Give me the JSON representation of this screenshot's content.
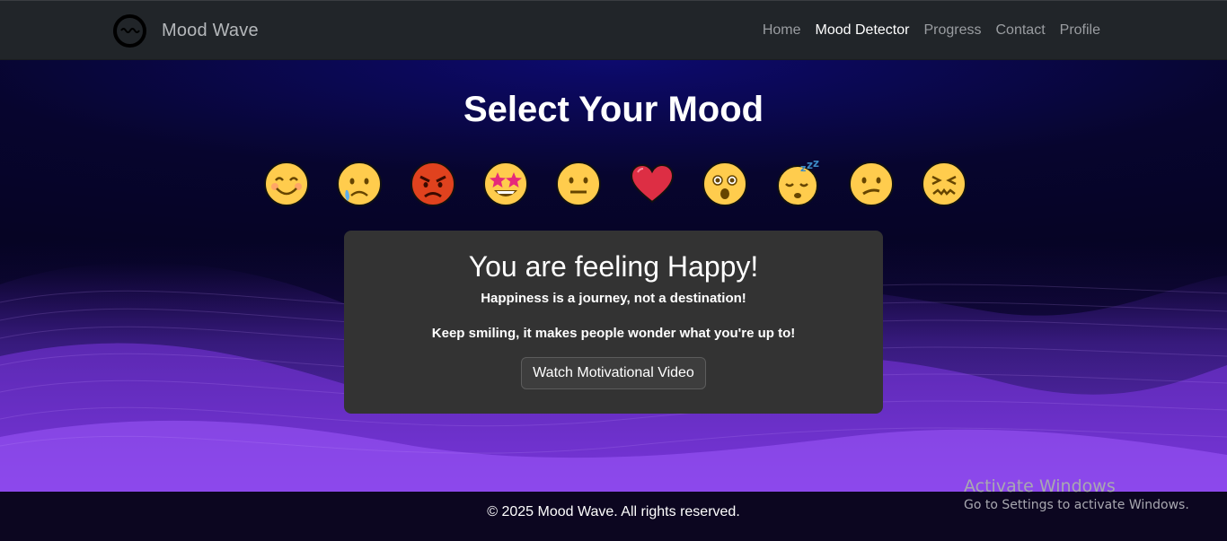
{
  "navbar": {
    "brand": "Mood Wave",
    "links": [
      {
        "label": "Home",
        "active": false
      },
      {
        "label": "Mood Detector",
        "active": true
      },
      {
        "label": "Progress",
        "active": false
      },
      {
        "label": "Contact",
        "active": false
      },
      {
        "label": "Profile",
        "active": false
      }
    ]
  },
  "main": {
    "title": "Select Your Mood",
    "moods": [
      {
        "icon": "smiling-face-icon",
        "mood": "happy"
      },
      {
        "icon": "crying-face-icon",
        "mood": "sad"
      },
      {
        "icon": "angry-face-icon",
        "mood": "angry"
      },
      {
        "icon": "star-struck-face-icon",
        "mood": "excited"
      },
      {
        "icon": "neutral-face-icon",
        "mood": "neutral"
      },
      {
        "icon": "red-heart-icon",
        "mood": "love"
      },
      {
        "icon": "astonished-face-icon",
        "mood": "surprised"
      },
      {
        "icon": "sleeping-face-icon",
        "mood": "tired"
      },
      {
        "icon": "confused-face-icon",
        "mood": "confused"
      },
      {
        "icon": "confounded-face-icon",
        "mood": "stressed"
      }
    ]
  },
  "card": {
    "title": "You are feeling Happy!",
    "quote": "Happiness is a journey, not a destination!",
    "tip": "Keep smiling, it makes people wonder what you're up to!",
    "button_label": "Watch Motivational Video"
  },
  "footer": {
    "text": "© 2025 Mood Wave. All rights reserved."
  },
  "watermark": {
    "title": "Activate Windows",
    "subtitle": "Go to Settings to activate Windows."
  },
  "colors": {
    "navbar_bg": "#212529",
    "card_bg": "#333333",
    "accent_purple": "#7b2ff7"
  }
}
